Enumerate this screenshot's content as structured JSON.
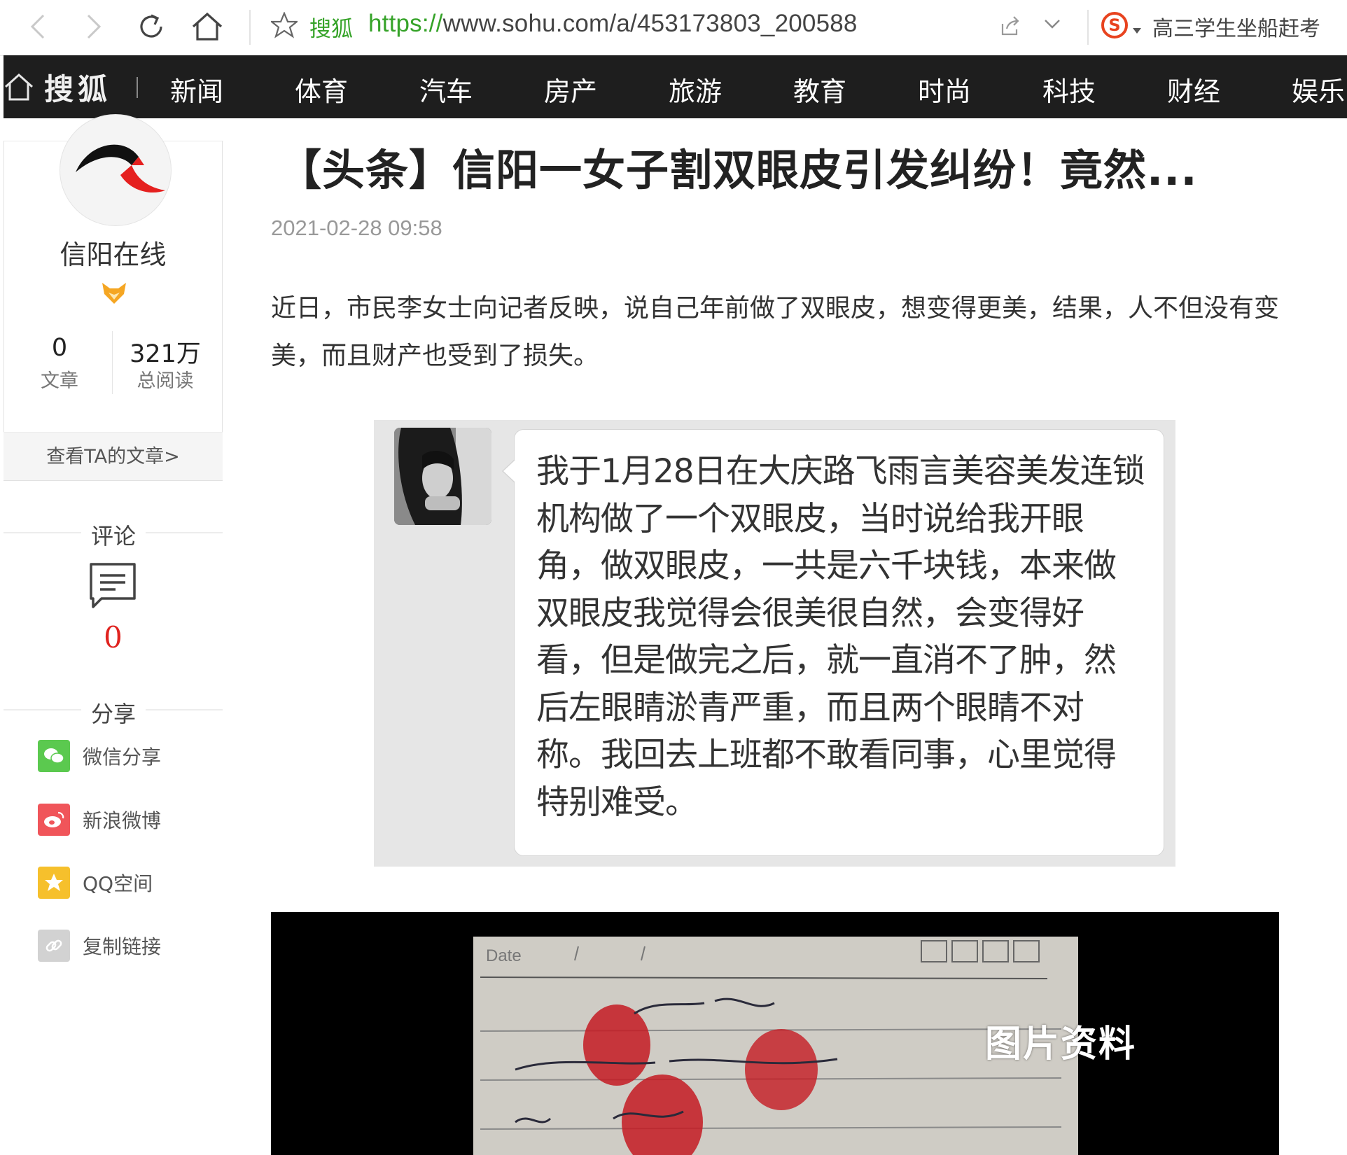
{
  "browser": {
    "site_name": "搜狐",
    "url_protocol": "https://",
    "url_rest": "www.sohu.com/a/453173803_200588",
    "search_query": "高三学生坐船赶考",
    "icons": [
      "back-icon",
      "forward-icon",
      "reload-icon",
      "home-icon",
      "favorite-star-icon",
      "share-icon",
      "chevron-down-icon",
      "sogou-search-icon"
    ]
  },
  "nav": {
    "logo_text": "搜狐",
    "items": [
      "新闻",
      "体育",
      "汽车",
      "房产",
      "旅游",
      "教育",
      "时尚",
      "科技",
      "财经",
      "娱乐"
    ]
  },
  "author": {
    "name": "信阳在线",
    "articles_count": "0",
    "articles_label": "文章",
    "reads_count": "321万",
    "reads_label": "总阅读",
    "view_articles": "查看TA的文章>"
  },
  "comments": {
    "title": "评论",
    "count": "0"
  },
  "share": {
    "title": "分享",
    "items": [
      {
        "label": "微信分享",
        "color": "#5bc94f"
      },
      {
        "label": "新浪微博",
        "color": "#f0555a"
      },
      {
        "label": "QQ空间",
        "color": "#f6c02c"
      },
      {
        "label": "复制链接",
        "color": "#d2d2d2"
      }
    ]
  },
  "article": {
    "title": "【头条】信阳一女子割双眼皮引发纠纷！竟然...",
    "time": "2021-02-28 09:58",
    "intro": "近日，市民李女士向记者反映，说自己年前做了双眼皮，想变得更美，结果，人不但没有变美，而且财产也受到了损失。",
    "chat_text": "我于1月28日在大庆路飞雨言美容美发连锁机构做了一个双眼皮，当时说给我开眼角，做双眼皮，一共是六千块钱，本来做双眼皮我觉得会很美很自然，会变得好看，但是做完之后，就一直消不了肿，然后左眼睛淤青严重，而且两个眼睛不对称。我回去上班都不敢看同事，心里觉得特别难受。",
    "photo_caption": "图片资料"
  },
  "colors": {
    "nav_bg": "#1e1e1e",
    "accent_green": "#36a329",
    "comment_red": "#e0231f"
  }
}
